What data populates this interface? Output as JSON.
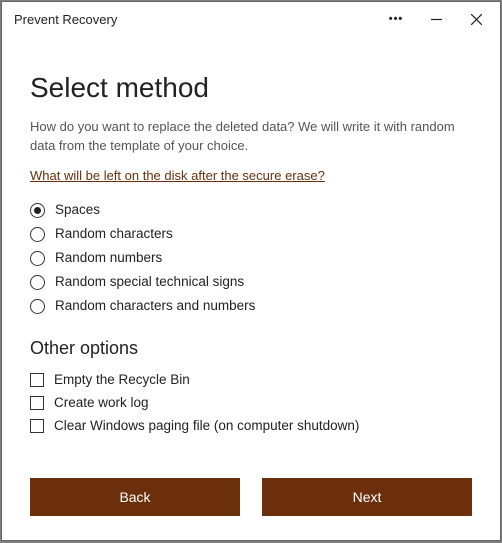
{
  "window": {
    "title": "Prevent Recovery"
  },
  "heading": "Select method",
  "description": "How do you want to replace the deleted data? We will write it with random data from the template of your choice.",
  "link_text": "What will be left on the disk after the secure erase?",
  "methods": {
    "selected_index": 0,
    "items": [
      {
        "label": "Spaces"
      },
      {
        "label": "Random characters"
      },
      {
        "label": "Random numbers"
      },
      {
        "label": "Random special technical signs"
      },
      {
        "label": "Random characters and numbers"
      }
    ]
  },
  "other_heading": "Other options",
  "other_options": [
    {
      "label": "Empty the Recycle Bin",
      "checked": false
    },
    {
      "label": "Create work log",
      "checked": false
    },
    {
      "label": "Clear Windows paging file (on computer shutdown)",
      "checked": false
    }
  ],
  "buttons": {
    "back": "Back",
    "next": "Next"
  },
  "colors": {
    "accent": "#6b2f0b"
  }
}
